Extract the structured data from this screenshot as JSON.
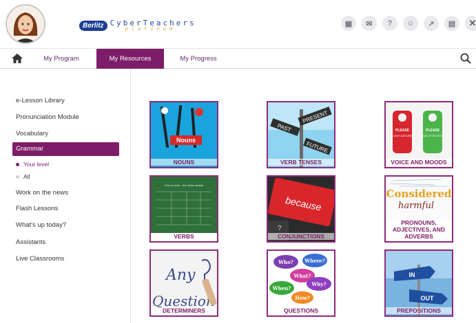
{
  "header": {
    "logo_badge": "Berlitz",
    "logo_main": "CyberTeachers",
    "logo_sub": "platinum",
    "icons": [
      "grid-icon",
      "mail-icon",
      "help-icon",
      "profile-icon",
      "chart-icon",
      "calendar-icon",
      "close-icon"
    ],
    "icon_glyphs": [
      "▦",
      "✉",
      "?",
      "☺",
      "↗",
      "▤",
      "✕"
    ]
  },
  "nav": {
    "tabs": [
      {
        "label": "My Program"
      },
      {
        "label": "My Resources"
      },
      {
        "label": "My Progress"
      }
    ],
    "active_tab": "My Resources"
  },
  "sidebar": {
    "items": [
      {
        "label": "e-Lesson Library"
      },
      {
        "label": "Pronunciation Module"
      },
      {
        "label": "Vocabulary"
      },
      {
        "label": "Grammar"
      },
      {
        "label": "Work on the news"
      },
      {
        "label": "Flash Lessons"
      },
      {
        "label": "What's up today?"
      },
      {
        "label": "Assistants"
      },
      {
        "label": "Live Classrooms"
      }
    ],
    "active_item": "Grammar",
    "sub_items": [
      {
        "label": "Your level"
      },
      {
        "label": "All"
      }
    ]
  },
  "cards": [
    {
      "label": "NOUNS",
      "image_text": "Nouns"
    },
    {
      "label": "VERB TENSES",
      "image_text": [
        "PAST",
        "PRESENT",
        "FUTURE"
      ]
    },
    {
      "label": "VOICE AND MOODS",
      "image_text": [
        "PLEASE",
        "DON'T DISTURB",
        "PLEASE",
        "MAKE UP THE ROOM"
      ]
    },
    {
      "label": "VERBS",
      "image_text": "How to work – the Verbs simple"
    },
    {
      "label": "CONJUNCTIONS",
      "image_text": "because"
    },
    {
      "label": "PRONOUNS, ADJECTIVES, AND ADVERBS",
      "image_text": [
        "Considered",
        "harmful"
      ]
    },
    {
      "label": "DETERMINERS",
      "image_text": [
        "Any",
        "Question"
      ]
    },
    {
      "label": "QUESTIONS",
      "image_text": [
        "Who?",
        "Where?",
        "What?",
        "Why?",
        "When?",
        "How?"
      ]
    },
    {
      "label": "PREPOSITIONS",
      "image_text": [
        "IN",
        "OUT"
      ]
    }
  ],
  "colors": {
    "accent": "#7d1c68",
    "card_border": "#8e2a7a",
    "logo_blue": "#1c3f95"
  }
}
